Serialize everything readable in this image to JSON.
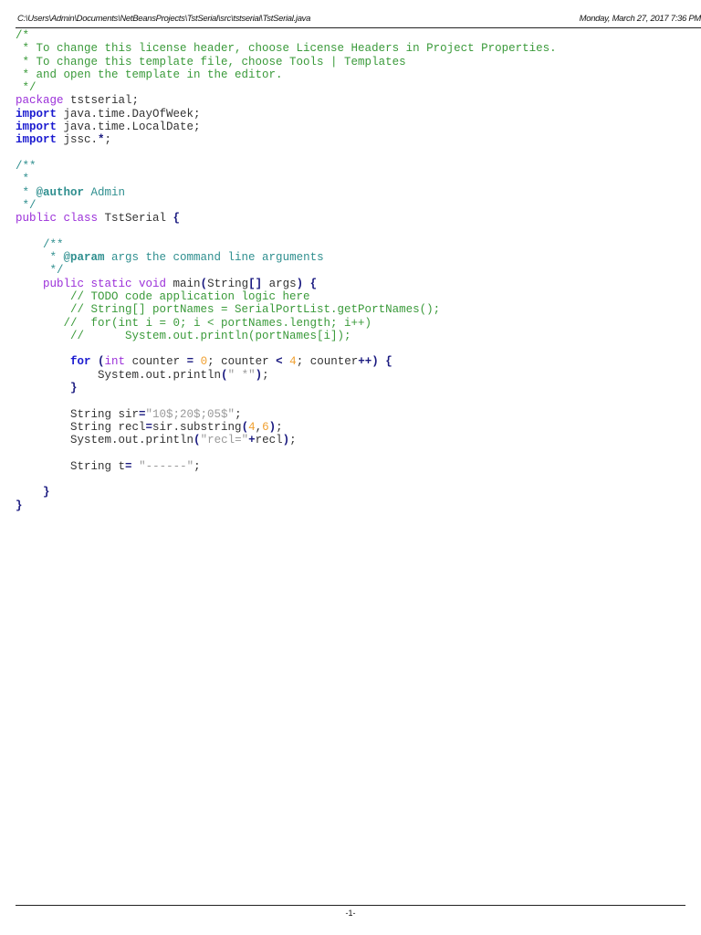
{
  "header": {
    "path": "C:\\Users\\Admin\\Documents\\NetBeansProjects\\TstSerial\\src\\tstserial\\TstSerial.java",
    "date": "Monday, March 27, 2017 7:36 PM"
  },
  "footer": {
    "page": "-1-"
  },
  "colors": {
    "comment": "#3a9a3a",
    "javadoc": "#2f8f8f",
    "keyword_purple": "#9b30d9",
    "keyword_blue": "#1a1ad0",
    "string": "#999999",
    "number": "#f0a030"
  },
  "code": [
    [
      [
        "c",
        "/*"
      ]
    ],
    [
      [
        "c",
        " * To change this license header, choose License Headers in Project Properties."
      ]
    ],
    [
      [
        "c",
        " * To change this template file, choose Tools | Templates"
      ]
    ],
    [
      [
        "c",
        " * and open the template in the editor."
      ]
    ],
    [
      [
        "c",
        " */"
      ]
    ],
    [
      [
        "kp",
        "package"
      ],
      [
        "p",
        " tstserial;"
      ]
    ],
    [
      [
        "kb",
        "import"
      ],
      [
        "p",
        " java.time.DayOfWeek;"
      ]
    ],
    [
      [
        "kb",
        "import"
      ],
      [
        "p",
        " java.time.LocalDate;"
      ]
    ],
    [
      [
        "kb",
        "import"
      ],
      [
        "p",
        " jssc."
      ],
      [
        "op",
        "*"
      ],
      [
        "p",
        ";"
      ]
    ],
    [],
    [
      [
        "jd",
        "/**"
      ]
    ],
    [
      [
        "jd",
        " *"
      ]
    ],
    [
      [
        "jd",
        " * "
      ],
      [
        "jt",
        "@author"
      ],
      [
        "jd",
        " Admin"
      ]
    ],
    [
      [
        "jd",
        " */"
      ]
    ],
    [
      [
        "kp",
        "public class"
      ],
      [
        "p",
        " TstSerial "
      ],
      [
        "op",
        "{"
      ]
    ],
    [],
    [
      [
        "jd",
        "    /**"
      ]
    ],
    [
      [
        "jd",
        "     * "
      ],
      [
        "jt",
        "@param"
      ],
      [
        "jd",
        " args the command line arguments"
      ]
    ],
    [
      [
        "jd",
        "     */"
      ]
    ],
    [
      [
        "kp",
        "    public static void"
      ],
      [
        "p",
        " main"
      ],
      [
        "op",
        "("
      ],
      [
        "p",
        "String"
      ],
      [
        "op",
        "[]"
      ],
      [
        "p",
        " args"
      ],
      [
        "op",
        ")"
      ],
      [
        "p",
        " "
      ],
      [
        "op",
        "{"
      ]
    ],
    [
      [
        "c",
        "        // TODO code application logic here"
      ]
    ],
    [
      [
        "c",
        "        // String[] portNames = SerialPortList.getPortNames();"
      ]
    ],
    [
      [
        "c",
        "       //  for(int i = 0; i < portNames.length; i++)"
      ]
    ],
    [
      [
        "c",
        "        //      System.out.println(portNames[i]);"
      ]
    ],
    [],
    [
      [
        "kb",
        "        for"
      ],
      [
        "p",
        " "
      ],
      [
        "op",
        "("
      ],
      [
        "kp",
        "int"
      ],
      [
        "p",
        " counter "
      ],
      [
        "op",
        "="
      ],
      [
        "p",
        " "
      ],
      [
        "n",
        "0"
      ],
      [
        "p",
        "; counter "
      ],
      [
        "op",
        "<"
      ],
      [
        "p",
        " "
      ],
      [
        "n",
        "4"
      ],
      [
        "p",
        "; counter"
      ],
      [
        "op",
        "++)"
      ],
      [
        "p",
        " "
      ],
      [
        "op",
        "{"
      ]
    ],
    [
      [
        "p",
        "            System.out.println"
      ],
      [
        "op",
        "("
      ],
      [
        "s",
        "\" *\""
      ],
      [
        "op",
        ")"
      ],
      [
        "p",
        ";"
      ]
    ],
    [
      [
        "op",
        "        }"
      ]
    ],
    [],
    [
      [
        "p",
        "        String sir"
      ],
      [
        "op",
        "="
      ],
      [
        "s",
        "\"10$;20$;05$\""
      ],
      [
        "p",
        ";"
      ]
    ],
    [
      [
        "p",
        "        String recl"
      ],
      [
        "op",
        "="
      ],
      [
        "p",
        "sir.substring"
      ],
      [
        "op",
        "("
      ],
      [
        "n",
        "4"
      ],
      [
        "p",
        ","
      ],
      [
        "n",
        "6"
      ],
      [
        "op",
        ")"
      ],
      [
        "p",
        ";"
      ]
    ],
    [
      [
        "p",
        "        System.out.println"
      ],
      [
        "op",
        "("
      ],
      [
        "s",
        "\"recl=\""
      ],
      [
        "op",
        "+"
      ],
      [
        "p",
        "recl"
      ],
      [
        "op",
        ")"
      ],
      [
        "p",
        ";"
      ]
    ],
    [],
    [
      [
        "p",
        "        String t"
      ],
      [
        "op",
        "="
      ],
      [
        "p",
        " "
      ],
      [
        "s",
        "\"------\""
      ],
      [
        "p",
        ";"
      ]
    ],
    [],
    [
      [
        "op",
        "    }"
      ]
    ],
    [
      [
        "op",
        "}"
      ]
    ]
  ]
}
